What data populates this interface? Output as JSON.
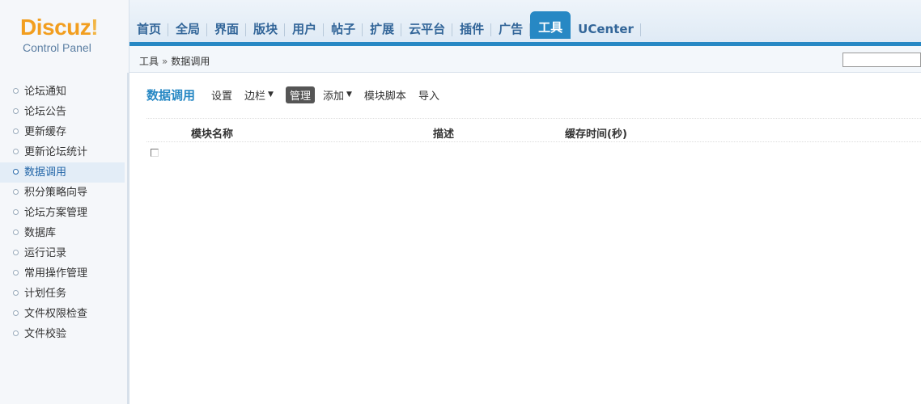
{
  "logo": {
    "text_part1": "Discuz",
    "text_part2": "!",
    "subtitle": "Control Panel"
  },
  "nav": {
    "items": [
      {
        "label": "首页"
      },
      {
        "label": "全局"
      },
      {
        "label": "界面"
      },
      {
        "label": "版块"
      },
      {
        "label": "用户"
      },
      {
        "label": "帖子"
      },
      {
        "label": "扩展"
      },
      {
        "label": "云平台"
      },
      {
        "label": "插件"
      },
      {
        "label": "广告"
      },
      {
        "label": "工具"
      },
      {
        "label": "UCenter"
      }
    ],
    "active": "工具"
  },
  "breadcrumb": {
    "parent": "工具",
    "separator": "»",
    "current": "数据调用"
  },
  "search": {
    "placeholder": ""
  },
  "sidebar": {
    "items": [
      {
        "label": "论坛通知"
      },
      {
        "label": "论坛公告"
      },
      {
        "label": "更新缓存"
      },
      {
        "label": "更新论坛统计"
      },
      {
        "label": "数据调用"
      },
      {
        "label": "积分策略向导"
      },
      {
        "label": "论坛方案管理"
      },
      {
        "label": "数据库"
      },
      {
        "label": "运行记录"
      },
      {
        "label": "常用操作管理"
      },
      {
        "label": "计划任务"
      },
      {
        "label": "文件权限检查"
      },
      {
        "label": "文件校验"
      }
    ],
    "active": "数据调用"
  },
  "toolbar": {
    "title": "数据调用",
    "settings": "设置",
    "sidebar": "边栏",
    "manage": "管理",
    "add": "添加",
    "script": "模块脚本",
    "import": "导入"
  },
  "table": {
    "columns": {
      "name": "模块名称",
      "desc": "描述",
      "cache": "缓存时间(秒)"
    }
  },
  "colors": {
    "accent": "#2788c4",
    "logo_orange": "#f29e1f"
  }
}
